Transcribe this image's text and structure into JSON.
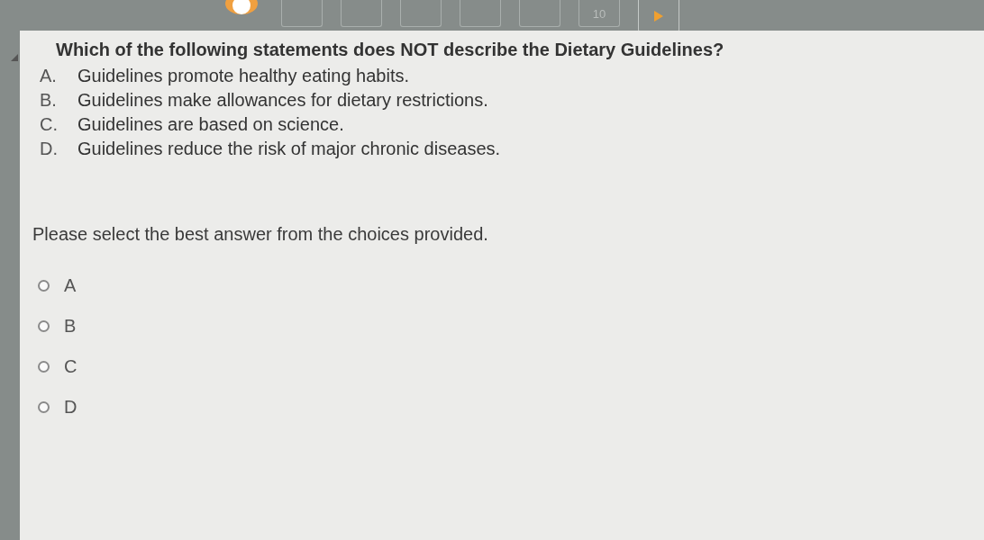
{
  "question_nav": {
    "items": [
      {
        "kind": "number"
      },
      {
        "kind": "number"
      },
      {
        "kind": "number"
      },
      {
        "kind": "number"
      },
      {
        "kind": "number"
      },
      {
        "kind": "number",
        "label": "10"
      },
      {
        "kind": "next"
      }
    ]
  },
  "question": {
    "text": "Which of the following statements does NOT describe the Dietary Guidelines?",
    "options": [
      {
        "letter": "A.",
        "text": "Guidelines promote healthy eating habits."
      },
      {
        "letter": "B.",
        "text": "Guidelines make allowances for dietary restrictions."
      },
      {
        "letter": "C.",
        "text": "Guidelines are based on science."
      },
      {
        "letter": "D.",
        "text": "Guidelines reduce the risk of major chronic diseases."
      }
    ]
  },
  "instruction": "Please select the best answer from the choices provided.",
  "choices": [
    {
      "label": "A",
      "selected": false
    },
    {
      "label": "B",
      "selected": false
    },
    {
      "label": "C",
      "selected": false
    },
    {
      "label": "D",
      "selected": false
    }
  ]
}
